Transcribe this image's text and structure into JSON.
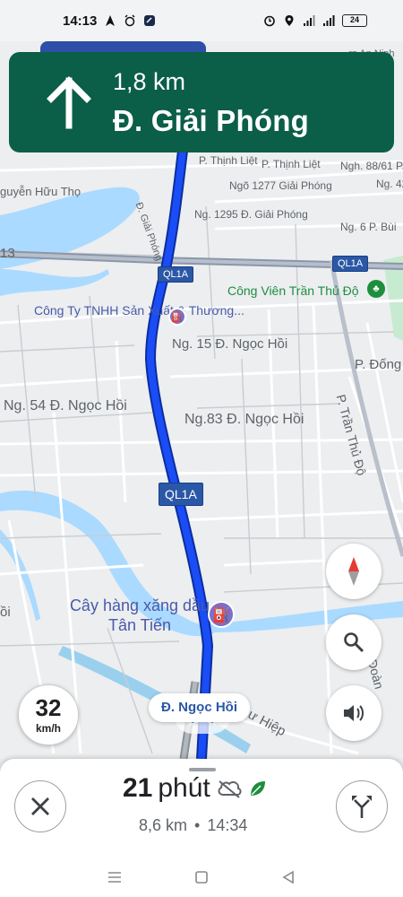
{
  "status_bar": {
    "time": "14:13",
    "battery": "24",
    "icons": [
      "navigation-icon",
      "alarm-icon",
      "message-icon",
      "alarm-clock-icon",
      "location-icon",
      "wifi-signal-icon",
      "cell-signal-icon"
    ]
  },
  "navigation": {
    "distance": "1,8 km",
    "street": "Đ. Giải Phóng",
    "direction_icon": "straight-arrow-icon"
  },
  "map": {
    "labels": [
      "P. Thịnh Liệt",
      "P. Thịnh Liệt",
      "Ngh. 88/61 P.",
      "guyễn Hữu Thọ",
      "Ngõ 1277 Giải Phóng",
      "Ng. 42",
      "Ng. 1295 Đ. Giải Phóng",
      "Ng. 6 P. Bùi",
      "Đ. Giải Phóng",
      "Công Viên Trần Thủ Độ",
      "Ng. 15 Đ. Ngọc Hồi",
      "P. Đống",
      "Ng. 54 Đ. Ngọc Hồi",
      "Ng.83 Đ. Ngọc Hồi",
      "P. Trần Thủ Độ",
      "ồi",
      "n Đoàn",
      "ư Hiệp",
      "13",
      "...rn An Ninh"
    ],
    "shields": [
      "QL1A",
      "QL1A",
      "QL1A"
    ],
    "poi_small": "Công Ty TNHH Sản Xuất & Thương...",
    "poi_large": "Cây hàng xăng dầu Tân Tiến",
    "colors": {
      "water": "#aadaff",
      "route": "#1a4df5",
      "road": "#ffffff",
      "land": "#eceef0",
      "park": "#c7ebd0"
    }
  },
  "speed": {
    "value": "32",
    "unit": "km/h"
  },
  "current_street": "Đ. Ngọc Hồi",
  "controls": [
    "compass-button",
    "search-button",
    "sound-button"
  ],
  "trip": {
    "eta_minutes": "21",
    "eta_unit": "phút",
    "distance": "8,6 km",
    "separator": "•",
    "arrival": "14:34"
  },
  "system_nav": [
    "menu-icon",
    "home-icon",
    "back-icon"
  ]
}
